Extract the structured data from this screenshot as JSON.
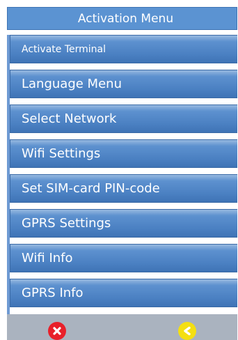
{
  "header": {
    "title": "Activation Menu"
  },
  "menu": {
    "items": [
      {
        "label": "Activate Terminal"
      },
      {
        "label": "Language Menu"
      },
      {
        "label": "Select Network"
      },
      {
        "label": "Wifi Settings"
      },
      {
        "label": "Set SIM-card PIN-code"
      },
      {
        "label": "GPRS Settings"
      },
      {
        "label": "Wifi Info"
      },
      {
        "label": "GPRS Info"
      }
    ]
  },
  "footer": {
    "cancel_icon": "close-icon",
    "back_icon": "back-arrow-icon"
  },
  "colors": {
    "title_bg": "#5b93d2",
    "item_bg": "#4a80c2",
    "footer_bg": "#aab3bf",
    "cancel": "#e8202a",
    "back": "#f4df12"
  }
}
